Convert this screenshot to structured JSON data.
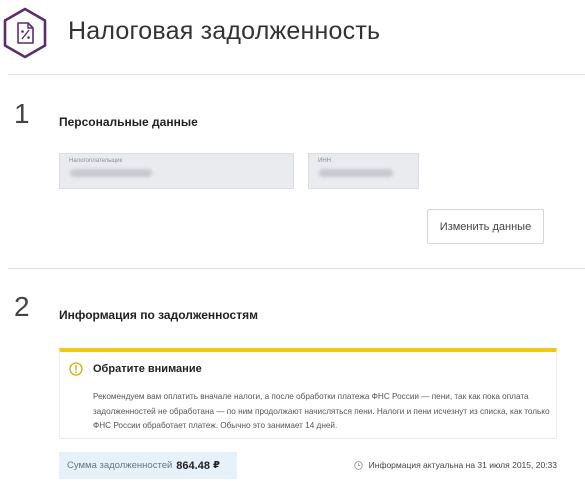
{
  "header": {
    "title": "Налоговая задолженность",
    "icon": "tax-document-icon",
    "accent_color": "#5b2c6f"
  },
  "sections": [
    {
      "number": "1",
      "title": "Персональные данные",
      "fields": [
        {
          "label": "Налогоплательщик",
          "value_state": "blurred"
        },
        {
          "label": "ИНН",
          "value_state": "blurred"
        }
      ],
      "change_button": "Изменить данные"
    },
    {
      "number": "2",
      "title": "Информация по задолженностям",
      "notice": {
        "icon": "warning-circle-icon",
        "border_color": "#f2c811",
        "title": "Обратите внимание",
        "text": "Рекомендуем вам оплатить вначале налоги, а после обработки платежа ФНС России — пени, так как пока оплата задолженностей не обработана — по ним продолжают начисляться пени. Налоги и пени исчезнут из списка, как только ФНС России обработает платеж. Обычно это занимает 14 дней."
      },
      "sum": {
        "label": "Сумма задолженностей",
        "value": "864.48",
        "currency": "₽",
        "background": "#e6f1f9"
      },
      "updated": {
        "icon": "clock-icon",
        "text": "Информация актуальна на 31 июля 2015, 20:33"
      }
    }
  ]
}
